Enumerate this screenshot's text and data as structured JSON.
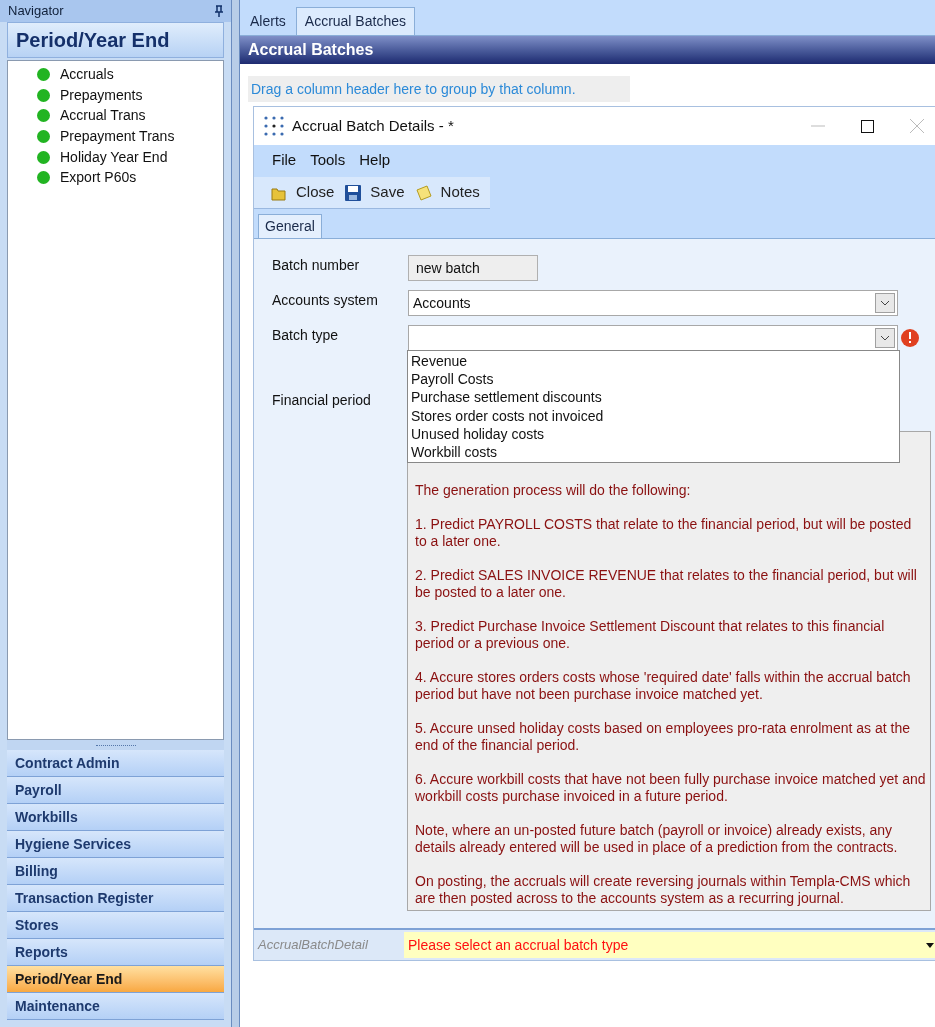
{
  "navigator": {
    "title": "Navigator",
    "section_title": "Period/Year End",
    "items": [
      {
        "label": "Accruals",
        "color": "#22b422"
      },
      {
        "label": "Prepayments",
        "color": "#22b422"
      },
      {
        "label": "Accrual Trans",
        "color": "#22b422"
      },
      {
        "label": "Prepayment Trans",
        "color": "#22b422"
      },
      {
        "label": "Holiday Year End",
        "color": "#22b422"
      },
      {
        "label": "Export P60s",
        "color": "#22b422"
      }
    ],
    "groups": [
      {
        "label": "Contract Admin",
        "selected": false
      },
      {
        "label": "Payroll",
        "selected": false
      },
      {
        "label": "Workbills",
        "selected": false
      },
      {
        "label": "Hygiene Services",
        "selected": false
      },
      {
        "label": "Billing",
        "selected": false
      },
      {
        "label": "Transaction Register",
        "selected": false
      },
      {
        "label": "Stores",
        "selected": false
      },
      {
        "label": "Reports",
        "selected": false
      },
      {
        "label": "Period/Year End",
        "selected": true
      },
      {
        "label": "Maintenance",
        "selected": false
      }
    ]
  },
  "tabs": [
    {
      "label": "Alerts",
      "selected": false
    },
    {
      "label": "Accrual Batches",
      "selected": true
    }
  ],
  "panel_title": "Accrual Batches",
  "group_hint": "Drag a column header here to group by that column.",
  "dialog": {
    "title": "Accrual Batch Details - *",
    "menu": [
      "File",
      "Tools",
      "Help"
    ],
    "toolbar": [
      {
        "label": "Close",
        "kind": "close"
      },
      {
        "label": "Save",
        "kind": "save"
      },
      {
        "label": "Notes",
        "kind": "notes"
      }
    ],
    "tabs": [
      {
        "label": "General",
        "selected": true
      }
    ],
    "fields": [
      {
        "label": "Batch number",
        "kind": "readonly",
        "value": "new batch"
      },
      {
        "label": "Accounts system",
        "kind": "combo",
        "value": "Accounts"
      },
      {
        "label": "Batch type",
        "kind": "combo",
        "error": true,
        "expanded": true
      }
    ],
    "financial_period_label": "Financial period",
    "options": [
      "Revenue",
      "Payroll Costs",
      "Purchase settlement discounts",
      "Stores order costs not invoiced",
      "Unused holiday costs",
      "Workbill costs"
    ],
    "description": [
      "The generation process will do the following:",
      "1. Predict PAYROLL COSTS that relate to the financial period, but will be posted to a later one.",
      "2. Predict SALES INVOICE REVENUE that relates to the financial period, but will be posted to a later one.",
      "3. Predict Purchase Invoice Settlement Discount that relates to this financial period or a previous one.",
      "4. Accure stores orders costs whose 'required date' falls within the accrual batch period but have not been purchase invoice matched yet.",
      "5. Accure unsed holiday costs based on employees pro-rata enrolment as at the end of the financial period.",
      "6. Accure workbill costs that have not been fully purchase invoice matched yet and workbill costs purchase invoiced in a future period.",
      "Note, where an un-posted future batch (payroll or invoice) already exists, any details already entered will be used in place of a prediction from the contracts.",
      "On posting, the accruals will create reversing journals within Templa-CMS which are then posted across to the accounts system as a recurring journal."
    ],
    "status": {
      "label": "AccrualBatchDetail",
      "message": "Please select an accrual batch type"
    }
  }
}
